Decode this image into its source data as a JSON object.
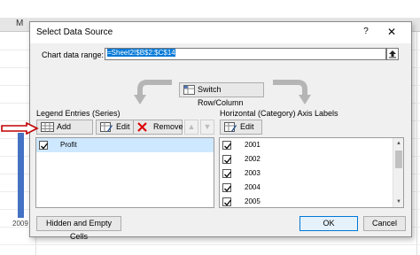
{
  "sheet": {
    "column_header": "M",
    "year_label": "2009",
    "bar_color": "#4472c4"
  },
  "dialog": {
    "title": "Select Data Source",
    "help_label": "?",
    "close_label": "✕",
    "range_label": "Chart data range:",
    "range_value": "=Sheet2!$B$2:$C$14",
    "switch_label": "Switch Row/Column",
    "legend_title": "Legend Entries (Series)",
    "axis_title": "Horizontal (Category) Axis Labels",
    "legend_toolbar": {
      "add": "Add",
      "edit": "Edit",
      "remove": "Remove",
      "up": "▲",
      "down": "▼"
    },
    "axis_toolbar": {
      "edit": "Edit"
    },
    "series": [
      {
        "label": "Profit",
        "checked": true
      }
    ],
    "categories": [
      {
        "label": "2001",
        "checked": true
      },
      {
        "label": "2002",
        "checked": true
      },
      {
        "label": "2003",
        "checked": true
      },
      {
        "label": "2004",
        "checked": true
      },
      {
        "label": "2005",
        "checked": true
      }
    ],
    "hidden_cells_label": "Hidden and Empty Cells",
    "ok_label": "OK",
    "cancel_label": "Cancel"
  },
  "colors": {
    "accent": "#0078d7",
    "annotation_arrow": "#c00000",
    "selection": "#cde8ff"
  },
  "icons": [
    "add-icon",
    "edit-icon",
    "remove-icon",
    "switch-icon",
    "collapse-icon",
    "checkbox-checked-icon",
    "curved-arrow-icon"
  ]
}
